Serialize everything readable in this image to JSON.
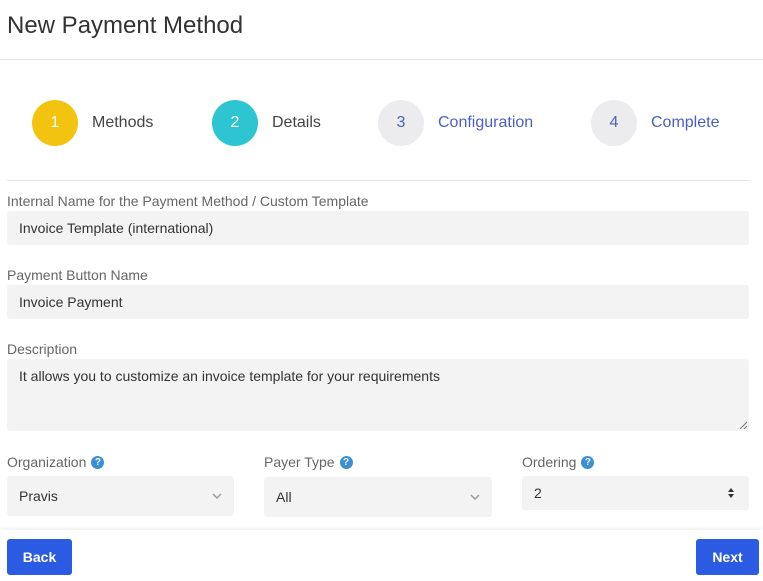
{
  "header": {
    "title": "New Payment Method"
  },
  "steps": [
    {
      "number": "1",
      "label": "Methods",
      "color": "#f2c40f"
    },
    {
      "number": "2",
      "label": "Details",
      "color": "#2ec5d3"
    },
    {
      "number": "3",
      "label": "Configuration",
      "color": "#ececee"
    },
    {
      "number": "4",
      "label": "Complete",
      "color": "#ececee"
    }
  ],
  "form": {
    "internal_name": {
      "label": "Internal Name for the Payment Method / Custom Template",
      "value": "Invoice Template (international)"
    },
    "button_name": {
      "label": "Payment Button Name",
      "value": "Invoice Payment"
    },
    "description": {
      "label": "Description",
      "value": "It allows you to customize an invoice template for your requirements"
    },
    "organization": {
      "label": "Organization",
      "value": "Pravis"
    },
    "payer_type": {
      "label": "Payer Type",
      "value": "All"
    },
    "ordering": {
      "label": "Ordering",
      "value": "2"
    }
  },
  "footer": {
    "back_label": "Back",
    "next_label": "Next",
    "accent": "#2c5be3"
  }
}
